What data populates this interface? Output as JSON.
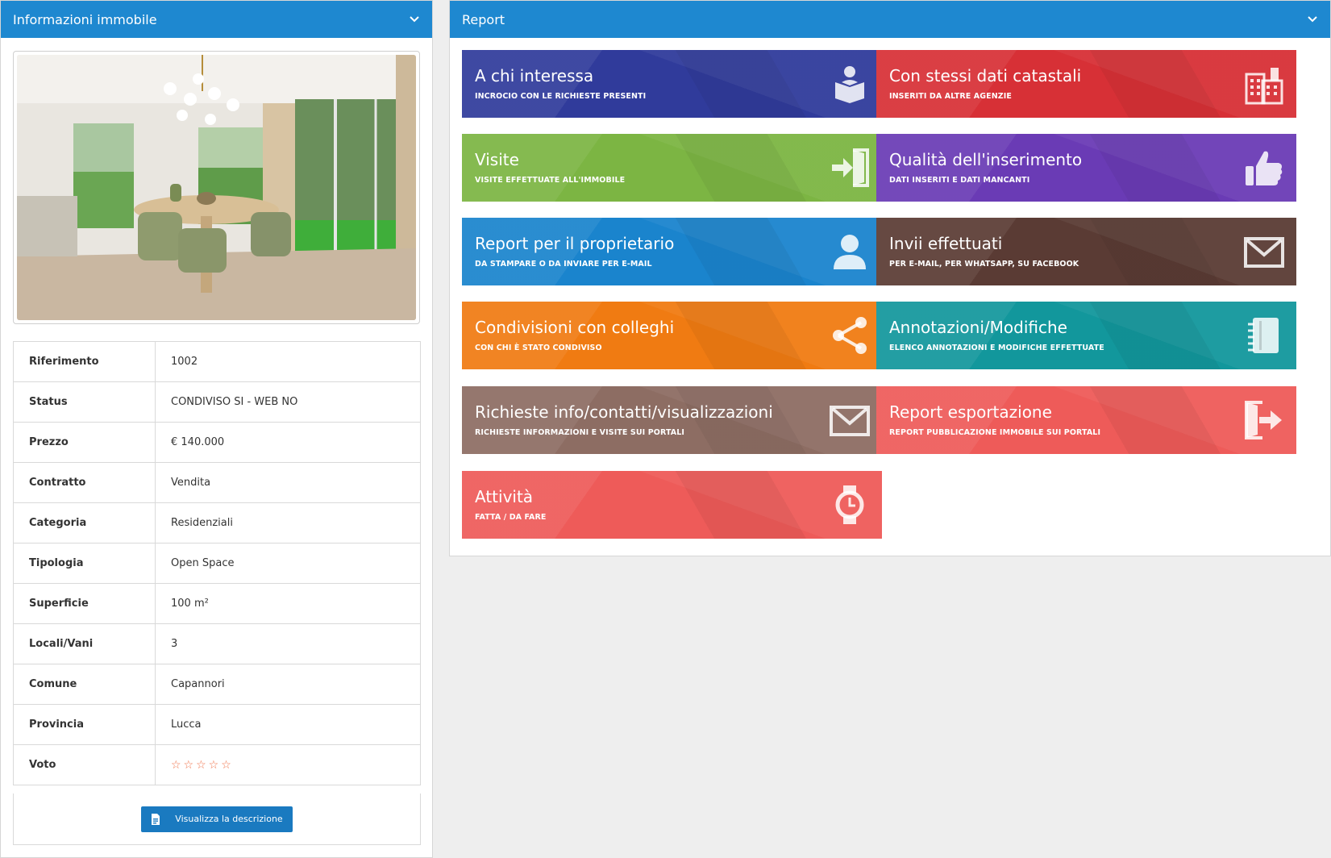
{
  "left_panel": {
    "title": "Informazioni immobile",
    "chevron_icon": "chevron-down-icon"
  },
  "photo_icon": "property-photo",
  "info_rows": [
    {
      "label": "Riferimento",
      "value": "1002"
    },
    {
      "label": "Status",
      "value": "CONDIVISO SI - WEB NO"
    },
    {
      "label": "Prezzo",
      "value": "€ 140.000"
    },
    {
      "label": "Contratto",
      "value": "Vendita"
    },
    {
      "label": "Categoria",
      "value": "Residenziali"
    },
    {
      "label": "Tipologia",
      "value": "Open Space"
    },
    {
      "label": "Superficie",
      "value": "100 m²"
    },
    {
      "label": "Locali/Vani",
      "value": "3"
    },
    {
      "label": "Comune",
      "value": "Capannori"
    },
    {
      "label": "Provincia",
      "value": "Lucca"
    },
    {
      "label": "Voto",
      "value": "☆☆☆☆☆"
    }
  ],
  "rating": {
    "filled": 0,
    "max": 5,
    "color": "#f0734a"
  },
  "description_button": {
    "label": "Visualizza la descrizione",
    "icon": "document-icon"
  },
  "right_panel": {
    "title": "Report",
    "chevron_icon": "chevron-down-icon"
  },
  "tiles": [
    {
      "title": "A chi interessa",
      "subtitle": "INCROCIO CON LE RICHIESTE PRESENTI",
      "color": "#303b9b",
      "icon": "person-reading-icon"
    },
    {
      "title": "Con stessi dati catastali",
      "subtitle": "INSERITI DA ALTRE AGENZIE",
      "color": "#d73036",
      "icon": "buildings-icon"
    },
    {
      "title": "Visite",
      "subtitle": "VISITE EFFETTUATE ALL'IMMOBILE",
      "color": "#7cb543",
      "icon": "sign-in-icon"
    },
    {
      "title": "Qualità dell'inserimento",
      "subtitle": "DATI INSERITI E DATI MANCANTI",
      "color": "#6a3bb5",
      "icon": "thumbs-up-icon"
    },
    {
      "title": "Report per il proprietario",
      "subtitle": "DA STAMPARE O DA INVIARE PER E-MAIL",
      "color": "#1a84cd",
      "icon": "user-icon"
    },
    {
      "title": "Invii effettuati",
      "subtitle": "PER E-MAIL, PER WHATSAPP, SU FACEBOOK",
      "color": "#5a3b34",
      "icon": "envelope-icon"
    },
    {
      "title": "Condivisioni con colleghi",
      "subtitle": "CON CHI È STATO CONDIVISO",
      "color": "#f07b12",
      "icon": "share-icon"
    },
    {
      "title": "Annotazioni/Modifiche",
      "subtitle": "ELENCO ANNOTAZIONI E MODIFICHE EFFETTUATE",
      "color": "#12979c",
      "icon": "notebook-icon"
    },
    {
      "title": "Richieste info/contatti/visualizzazioni",
      "subtitle": "RICHIESTE INFORMAZIONI E VISITE SUI PORTALI",
      "color": "#8d6d63",
      "icon": "envelope-icon"
    },
    {
      "title": "Report esportazione",
      "subtitle": "REPORT PUBBLICAZIONE IMMOBILE SUI PORTALI",
      "color": "#ee5b59",
      "icon": "sign-out-icon"
    },
    {
      "title": "Attività",
      "subtitle": "FATTA / DA FARE",
      "color": "#ee5b59",
      "icon": "watch-icon"
    }
  ]
}
